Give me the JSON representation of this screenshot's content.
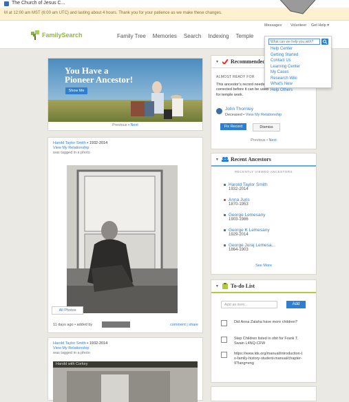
{
  "browser": {
    "tab_title": "The Church of Jesus C..."
  },
  "banner": {
    "text": "M at 12:00 am MST (6:00 am UTC) and lasting about 4 hours. Thank you for your patience as we make these changes."
  },
  "header": {
    "logo_text": "FamilySearch",
    "nav": [
      "Family Tree",
      "Memories",
      "Search",
      "Indexing",
      "Temple"
    ],
    "util": {
      "messages": "Messages",
      "volunteer": "Volunteer",
      "get_help": "Get Help ▾"
    }
  },
  "help_menu": {
    "search_placeholder": "What can we help you with?",
    "items": [
      "Help Center",
      "Getting Started",
      "Contact Us",
      "Learning Center",
      "My Cases",
      "Research Wiki",
      "What's New",
      "Help Others"
    ]
  },
  "hero": {
    "title_line1": "You Have a",
    "title_line2": "Pioneer Ancestor!",
    "button": "Show Me",
    "pager_prev": "Previous",
    "pager_sep": " • ",
    "pager_next": "Next"
  },
  "post1": {
    "who": "Harold Taylor Smith",
    "dates": " • 1932-2014",
    "relationship": "View My Relationship",
    "action": "was tagged in a photo",
    "all_photos": "All Photos",
    "footer_left": "11 days ago • added by",
    "footer_right": "comment | share"
  },
  "post2": {
    "who": "Harold Taylor Smith",
    "dates": " • 1932-2014",
    "relationship": "View My Relationship",
    "action": "was tagged in a photo",
    "caption": "Harold with Corkey"
  },
  "recommended": {
    "title": "Recommended",
    "caps": "ALMOST READY FOR",
    "text": "This ancestor's record needs corrected before it can be used for temple work.",
    "person_name": "John Thornley",
    "person_status": "Deceased • ",
    "person_link": "View My Relationship",
    "fix_button": "Fix Record",
    "dismiss_button": "Dismiss",
    "pager_prev": "Previous",
    "pager_sep": " • ",
    "pager_next": "Next"
  },
  "recent_ancestors": {
    "title": "Recent Ancestors",
    "subtitle": "RECENTLY VIEWED ANCESTORS",
    "items": [
      {
        "name": "Harold Taylor Smith",
        "years": "1932-2014"
      },
      {
        "name": "Anna Juris",
        "years": "1870-1953"
      },
      {
        "name": "George Lemesany",
        "years": "1903-1986"
      },
      {
        "name": "George K Lemesany",
        "years": "1929-2014"
      },
      {
        "name": "George Juraj Lemesa...",
        "years": "1864-1903"
      }
    ],
    "see_more": "See More"
  },
  "todo": {
    "title": "To-do List",
    "input_placeholder": "Add an item...",
    "add_button": "Add",
    "items": [
      "Did Anna Zalaha have more children?",
      "Step Children listed in obit for Frank T. Swain L4NQ-CFW",
      "https://www.lds.org/manual/introduction-to-family-history-student-manual/chapter-9?lang=eng"
    ]
  },
  "colors": {
    "accent": "#2d7fd2",
    "brand_green": "#8cb843",
    "banner": "#fdf1cf",
    "background": "#ebe9e4"
  }
}
